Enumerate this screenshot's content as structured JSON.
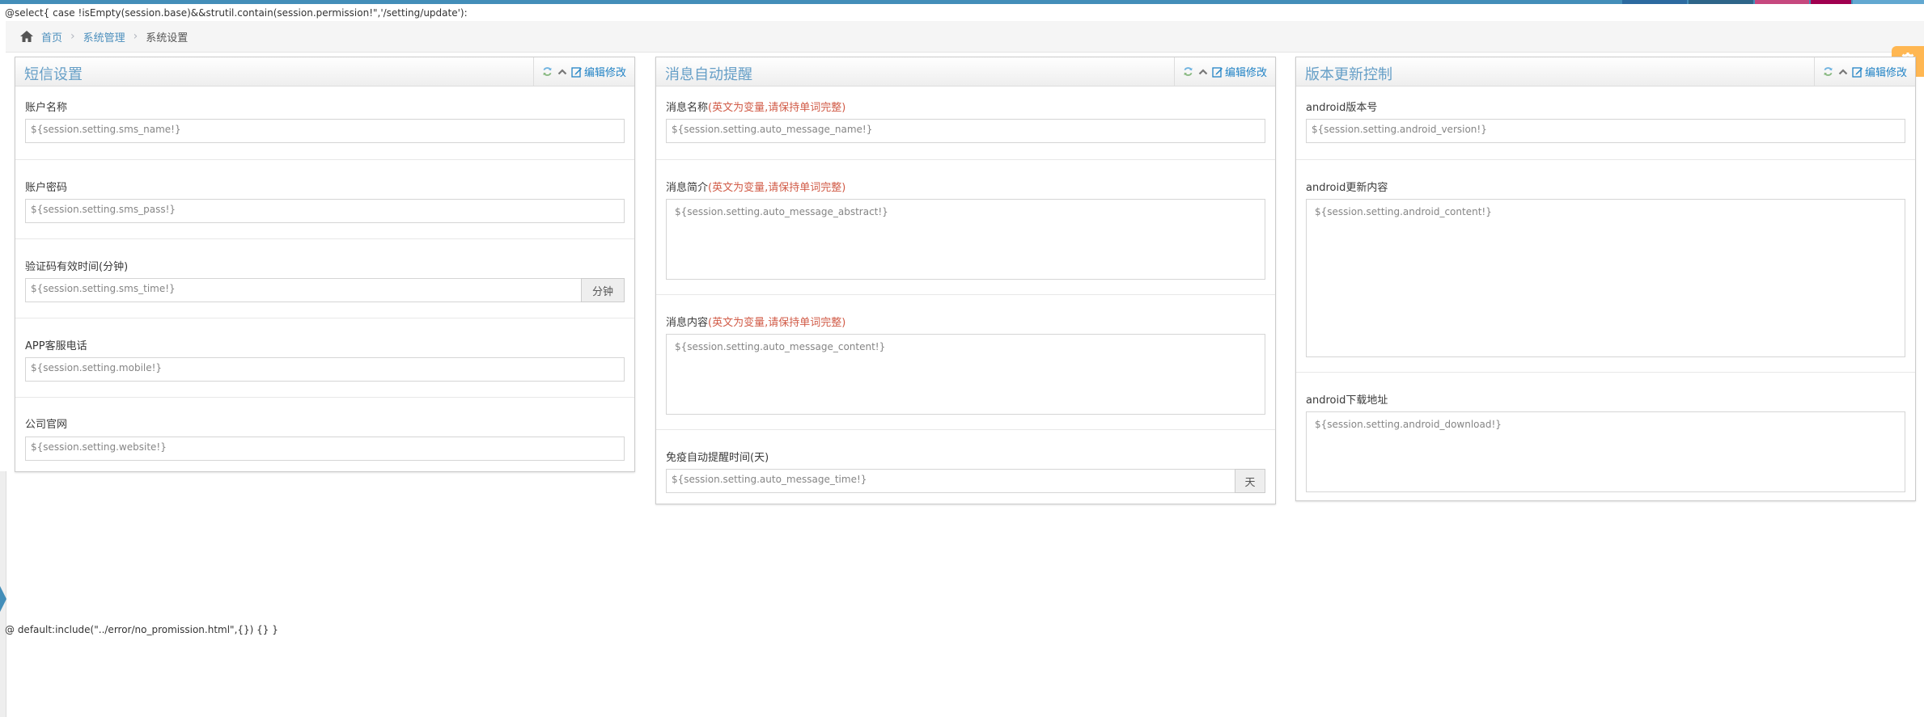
{
  "template": {
    "header_text": "@select{ case !isEmpty(session.base)&&strutil.contain(session.permission!\",'/setting/update'):",
    "footer_text": "@ default:include(\"../error/no_promission.html\",{}) {} }"
  },
  "breadcrumb": {
    "home": "首页",
    "items": [
      "系统管理",
      "系统设置"
    ]
  },
  "panels": {
    "sms": {
      "title": "短信设置",
      "action": "编辑修改",
      "fields": [
        {
          "label": "账户名称",
          "value": "${session.setting.sms_name!}"
        },
        {
          "label": "账户密码",
          "value": "${session.setting.sms_pass!}"
        },
        {
          "label": "验证码有效时间(分钟)",
          "value": "${session.setting.sms_time!}",
          "addon": "分钟"
        },
        {
          "label": "APP客服电话",
          "value": "${session.setting.mobile!}"
        },
        {
          "label": "公司官网",
          "value": "${session.setting.website!}"
        }
      ]
    },
    "message": {
      "title": "消息自动提醒",
      "action": "编辑修改",
      "note": "(英文为变量,请保持单词完整)",
      "fields": [
        {
          "label": "消息名称",
          "value": "${session.setting.auto_message_name!}"
        },
        {
          "label": "消息简介",
          "value": "${session.setting.auto_message_abstract!}"
        },
        {
          "label": "消息内容",
          "value": "${session.setting.auto_message_content!}"
        },
        {
          "label": "免疫自动提醒时间(天)",
          "value": "${session.setting.auto_message_time!}",
          "addon": "天"
        }
      ]
    },
    "version": {
      "title": "版本更新控制",
      "action": "编辑修改",
      "fields": [
        {
          "label": "android版本号",
          "value": "${session.setting.android_version!}"
        },
        {
          "label": "android更新内容",
          "value": "${session.setting.android_content!}"
        },
        {
          "label": "android下载地址",
          "value": "${session.setting.android_download!}"
        }
      ]
    }
  },
  "colors": {
    "brand": "#438eb9",
    "title": "#669fc7",
    "link": "#2283c5",
    "refresh": "#6fb3e0",
    "note_red": "#d15b47",
    "settings": "#ffb752"
  }
}
